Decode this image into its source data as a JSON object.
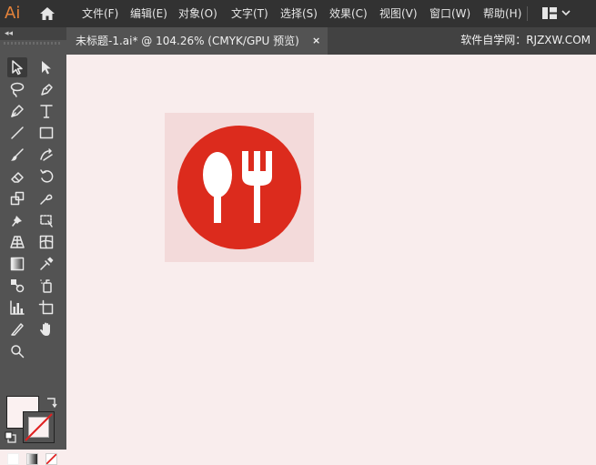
{
  "app": {
    "logo_text": "Ai"
  },
  "menubar": {
    "items": [
      {
        "label": "文件(F)"
      },
      {
        "label": "编辑(E)"
      },
      {
        "label": "对象(O)"
      },
      {
        "label": "文字(T)"
      },
      {
        "label": "选择(S)"
      },
      {
        "label": "效果(C)"
      },
      {
        "label": "视图(V)"
      },
      {
        "label": "窗口(W)"
      },
      {
        "label": "帮助(H)"
      }
    ]
  },
  "toolbar": {
    "collapse_glyph": "◂◂"
  },
  "document": {
    "tab_title": "未标题-1.ai* @ 104.26% (CMYK/GPU 预览)",
    "close_glyph": "×"
  },
  "watermark": "软件自学网：RJZXW.COM",
  "colors": {
    "menubar_bg": "#323232",
    "toolbar_bg": "#535353",
    "canvas_bg": "#f9eded",
    "artboard_bg": "#f3dada",
    "icon_red": "#dc2b1d",
    "logo_orange": "#e5833a"
  },
  "artwork": {
    "icon": "restaurant-spoon-fork-icon"
  }
}
